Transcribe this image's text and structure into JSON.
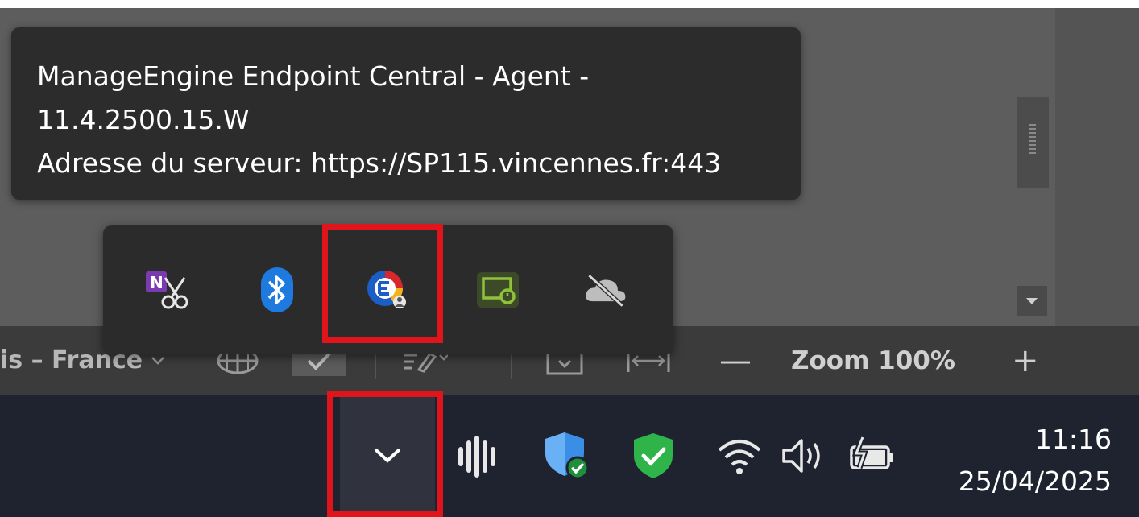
{
  "tooltip": {
    "line1": "ManageEngine Endpoint Central - Agent -",
    "line2": "11.4.2500.15.W",
    "line3": "Adresse du serveur: https://SP115.vincennes.fr:443"
  },
  "tray_icons": [
    {
      "name": "onenote-clipper-icon"
    },
    {
      "name": "bluetooth-icon"
    },
    {
      "name": "endpoint-central-agent-icon",
      "highlighted": true
    },
    {
      "name": "screen-capture-icon"
    },
    {
      "name": "onedrive-offline-icon"
    }
  ],
  "status_bar": {
    "language": "is – France",
    "zoom_label": "Zoom 100%",
    "zoom_out": "—",
    "zoom_in": "+"
  },
  "taskbar": {
    "time": "11:16",
    "date": "25/04/2025"
  },
  "colors": {
    "highlight": "#e0141b",
    "taskbar": "#1f2330",
    "flyout": "#2b2b2b",
    "onenote": "#7a3bb0",
    "bluetooth": "#1f7ae0",
    "green_shield": "#2fb44a",
    "capture": "#8fc23a"
  }
}
